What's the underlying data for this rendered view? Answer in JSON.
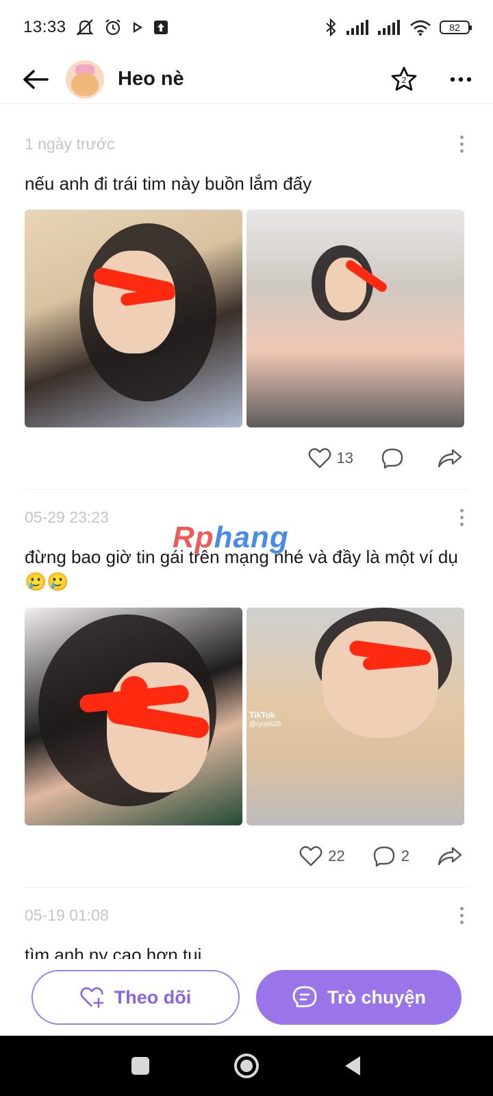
{
  "status_bar": {
    "time": "13:33",
    "battery": "82"
  },
  "header": {
    "name": "Heo nè",
    "star_badge": "2"
  },
  "posts": [
    {
      "time": "1 ngày trước",
      "text": "nếu anh đi trái tim này buồn lắm đấy",
      "likes": "13",
      "comments": ""
    },
    {
      "time": "05-29 23:23",
      "text": "đừng bao giờ tin gái trên mạng nhé và đầy là một ví dụ 🥲🥲",
      "likes": "22",
      "comments": "2",
      "tiktok_label": "TikTok",
      "tiktok_user": "@ryne628"
    },
    {
      "time": "05-19 01:08",
      "text": "tìm anh ny cao hơn tui"
    }
  ],
  "watermark": {
    "part1": "Rp",
    "part2": "hang"
  },
  "bottom": {
    "follow_label": "Theo dõi",
    "chat_label": "Trò chuyện"
  },
  "colors": {
    "accent": "#9a75ea",
    "redaction": "#ff2a0f"
  }
}
